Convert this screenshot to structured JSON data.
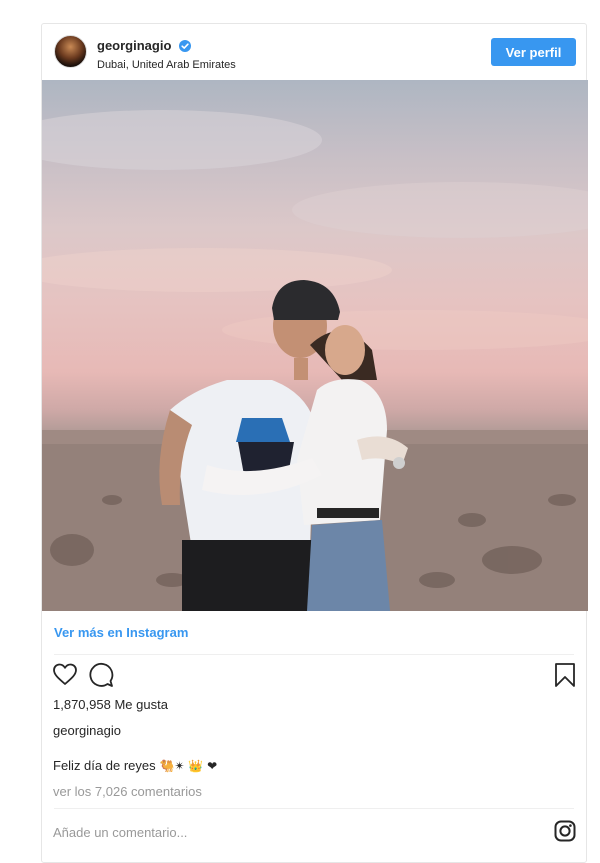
{
  "header": {
    "username": "georginagio",
    "location": "Dubai, United Arab Emirates",
    "view_profile_label": "Ver perfil",
    "verified_badge_icon": "verified-icon",
    "accent": "#3897f0"
  },
  "main": {
    "see_more_label": "Ver más en Instagram",
    "actions": {
      "like_icon": "heart-icon",
      "comment_icon": "comment-icon",
      "save_icon": "bookmark-icon"
    },
    "likes_text": "1,870,958 Me gusta",
    "owner": "georginagio",
    "caption_text": "Feliz día de reyes",
    "caption_emojis": "🐫✴ 👑 ❤",
    "comments_link": "ver los 7,026 comentarios",
    "comment_placeholder": "Añade un comentario...",
    "instagram_icon": "instagram-logo-icon"
  }
}
